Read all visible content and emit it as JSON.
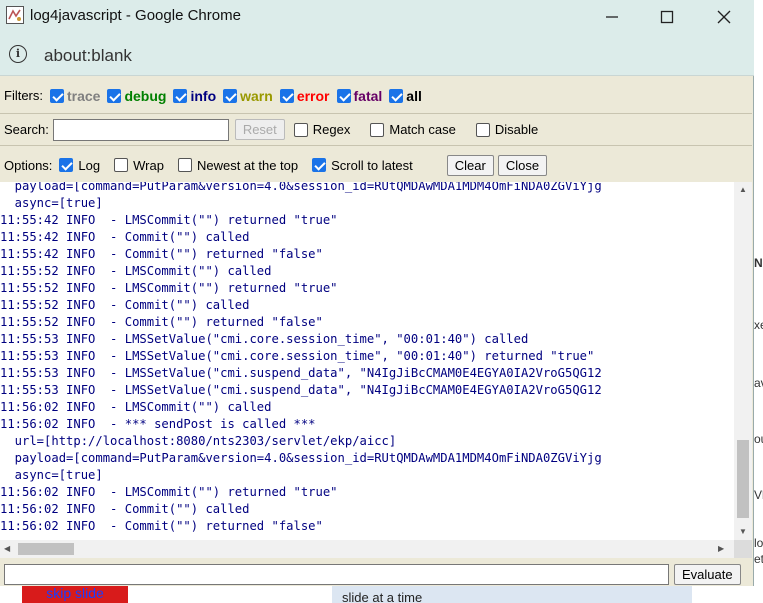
{
  "window": {
    "title": "log4javascript - Google Chrome",
    "url": "about:blank"
  },
  "filters": {
    "label": "Filters:",
    "items": [
      {
        "label": "trace",
        "checked": true,
        "color": "#808080"
      },
      {
        "label": "debug",
        "checked": true,
        "color": "#008000"
      },
      {
        "label": "info",
        "checked": true,
        "color": "#000080"
      },
      {
        "label": "warn",
        "checked": true,
        "color": "#999900"
      },
      {
        "label": "error",
        "checked": true,
        "color": "#ff0000"
      },
      {
        "label": "fatal",
        "checked": true,
        "color": "#660066"
      },
      {
        "label": "all",
        "checked": true,
        "color": "#000000"
      }
    ]
  },
  "search": {
    "label": "Search:",
    "value": "",
    "reset_label": "Reset",
    "regex_label": "Regex",
    "matchcase_label": "Match case",
    "disable_label": "Disable"
  },
  "options": {
    "label": "Options:",
    "log_label": "Log",
    "wrap_label": "Wrap",
    "newest_label": "Newest at the top",
    "scroll_label": "Scroll to latest",
    "clear_label": "Clear",
    "close_label": "Close"
  },
  "log_lines": [
    "  payload=[command=PutParam&version=4.0&session_id=RUtQMDAwMDA1MDM4OmFiNDA0ZGViYjg",
    "  async=[true]",
    "11:55:42 INFO  - LMSCommit(\"\") returned \"true\"",
    "11:55:42 INFO  - Commit(\"\") called",
    "11:55:42 INFO  - Commit(\"\") returned \"false\"",
    "11:55:52 INFO  - LMSCommit(\"\") called",
    "11:55:52 INFO  - LMSCommit(\"\") returned \"true\"",
    "11:55:52 INFO  - Commit(\"\") called",
    "11:55:52 INFO  - Commit(\"\") returned \"false\"",
    "11:55:53 INFO  - LMSSetValue(\"cmi.core.session_time\", \"00:01:40\") called",
    "11:55:53 INFO  - LMSSetValue(\"cmi.core.session_time\", \"00:01:40\") returned \"true\"",
    "11:55:53 INFO  - LMSSetValue(\"cmi.suspend_data\", \"N4IgJiBcCMAM0E4EGYA0IA2VroG5QG12",
    "11:55:53 INFO  - LMSSetValue(\"cmi.suspend_data\", \"N4IgJiBcCMAM0E4EGYA0IA2VroG5QG12",
    "11:56:02 INFO  - LMSCommit(\"\") called",
    "11:56:02 INFO  - *** sendPost is called ***",
    "  url=[http://localhost:8080/nts2303/servlet/ekp/aicc]",
    "  payload=[command=PutParam&version=4.0&session_id=RUtQMDAwMDA1MDM4OmFiNDA0ZGViYjg",
    "  async=[true]",
    "11:56:02 INFO  - LMSCommit(\"\") returned \"true\"",
    "11:56:02 INFO  - Commit(\"\") called",
    "11:56:02 INFO  - Commit(\"\") returned \"false\""
  ],
  "evaluate": {
    "value": "",
    "button_label": "Evaluate"
  },
  "background": {
    "skip_label": "skip slide",
    "slide_note": "slide at a time",
    "side_fragments": [
      "N",
      "xe",
      "av",
      "ou",
      "Vh",
      "lo",
      "ets"
    ]
  }
}
